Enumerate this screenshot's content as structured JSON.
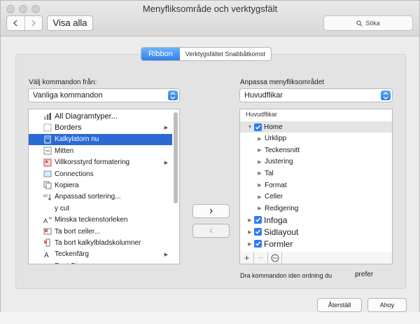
{
  "window": {
    "title": "Menyfliksområde och verktygsfält",
    "show_all_label": "Visa alla",
    "search_placeholder": "Söka"
  },
  "tabs": [
    {
      "label": "Ribbon",
      "active": true
    },
    {
      "label": "Verktygsfältet Snabbåtkomst",
      "active": false
    }
  ],
  "left": {
    "choose_label": "Välj kommandon från:",
    "choose_value": "Vanliga kommandon",
    "commands": [
      {
        "label": "All Diagramtyper...",
        "icon": "chart-icon",
        "submenu": false
      },
      {
        "label": "Borders",
        "icon": "borders-icon",
        "submenu": true
      },
      {
        "label": "Kalkylatorn nu",
        "icon": "calculator-icon",
        "submenu": false,
        "selected": true
      },
      {
        "label": "Mitten",
        "icon": "center-icon",
        "submenu": false
      },
      {
        "label": "Villkorsstyrd formatering",
        "icon": "conditional-format-icon",
        "submenu": true
      },
      {
        "label": "Connections",
        "icon": "connections-icon",
        "submenu": false
      },
      {
        "label": "Kopiera",
        "icon": "copy-icon",
        "submenu": false
      },
      {
        "label": "Anpassad sortering...",
        "icon": "sort-icon",
        "submenu": false
      },
      {
        "label": "y cut",
        "icon": "",
        "submenu": false
      },
      {
        "label": "Minska teckenstorleken",
        "icon": "decrease-font-icon",
        "submenu": false
      },
      {
        "label": "Ta bort celler...",
        "icon": "delete-cells-icon",
        "submenu": false
      },
      {
        "label": "Ta bort kalkylbladskolumner",
        "icon": "delete-columns-icon",
        "submenu": false
      },
      {
        "label": "Teckenfärg",
        "icon": "font-color-icon",
        "submenu": true
      },
      {
        "label": "Font Si...",
        "icon": "font-size-icon",
        "submenu": false
      }
    ]
  },
  "right": {
    "customize_label": "Anpassa menyfliksområdet",
    "customize_value": "Huvudflikar",
    "tree_header": "Huvudflikar",
    "tree": [
      {
        "label": "Home",
        "level": 0,
        "expanded": true,
        "checked": true
      },
      {
        "label": "Urklipp",
        "level": 1
      },
      {
        "label": "Teckensnitt",
        "level": 1
      },
      {
        "label": "Justering",
        "level": 1
      },
      {
        "label": "Tal",
        "level": 1
      },
      {
        "label": "Format",
        "level": 1
      },
      {
        "label": "Celler",
        "level": 1
      },
      {
        "label": "Redigering",
        "level": 1
      },
      {
        "label": "Infoga",
        "level": 0,
        "expanded": false,
        "checked": true
      },
      {
        "label": "Sidlayout",
        "level": 0,
        "expanded": false,
        "checked": true
      },
      {
        "label": "Formler",
        "level": 0,
        "expanded": false,
        "checked": true
      }
    ],
    "hint": "Dra kommandon iden ordning du",
    "hint2": "prefer"
  },
  "buttons": {
    "add": "›",
    "remove": "‹",
    "reset": "Återställ",
    "save": "Ahoy"
  },
  "colors": {
    "accent": "#2b6ad5",
    "check": "#2d7cf0"
  }
}
